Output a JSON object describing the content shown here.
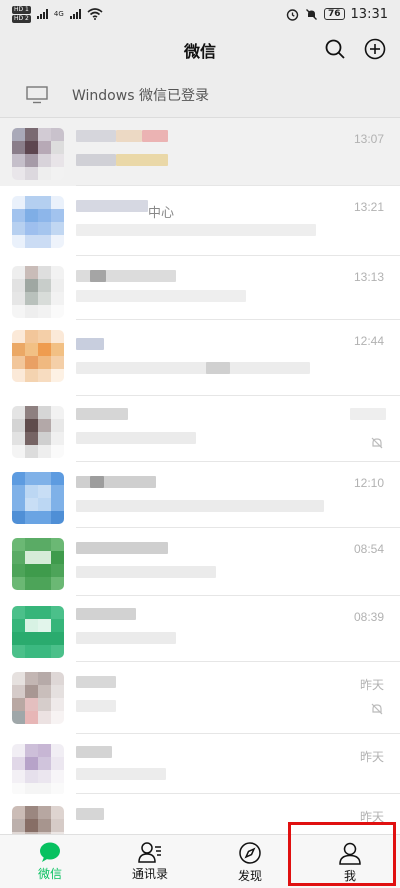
{
  "status_bar": {
    "sim1": "HD 1",
    "sim2": "HD 2",
    "net": "4G",
    "battery": "76",
    "time": "13:31"
  },
  "header": {
    "title": "微信",
    "search_icon": "search-icon",
    "add_icon": "add-icon"
  },
  "login_banner": {
    "icon": "monitor-icon",
    "text": "Windows 微信已登录"
  },
  "chats": [
    {
      "time": "13:07",
      "name": "",
      "muted": false,
      "pinned": true
    },
    {
      "time": "13:21",
      "name": "中心",
      "muted": false,
      "pinned": false
    },
    {
      "time": "13:13",
      "name": "",
      "muted": false,
      "pinned": false
    },
    {
      "time": "12:44",
      "name": "",
      "muted": false,
      "pinned": false
    },
    {
      "time": "",
      "name": "",
      "muted": true,
      "pinned": false
    },
    {
      "time": "12:10",
      "name": "",
      "muted": false,
      "pinned": false
    },
    {
      "time": "08:54",
      "name": "",
      "muted": false,
      "pinned": false
    },
    {
      "time": "08:39",
      "name": "",
      "muted": false,
      "pinned": false
    },
    {
      "time": "昨天",
      "name": "",
      "muted": true,
      "pinned": false
    },
    {
      "time": "昨天",
      "name": "",
      "muted": false,
      "pinned": false
    },
    {
      "time": "昨天",
      "name": "",
      "muted": false,
      "pinned": false
    }
  ],
  "tabs": [
    {
      "label": "微信",
      "icon": "chat-bubble-icon",
      "active": true
    },
    {
      "label": "通讯录",
      "icon": "contacts-icon",
      "active": false
    },
    {
      "label": "发现",
      "icon": "compass-icon",
      "active": false
    },
    {
      "label": "我",
      "icon": "person-icon",
      "active": false
    }
  ],
  "colors": {
    "accent": "#07c160",
    "highlight": "#e01010"
  }
}
